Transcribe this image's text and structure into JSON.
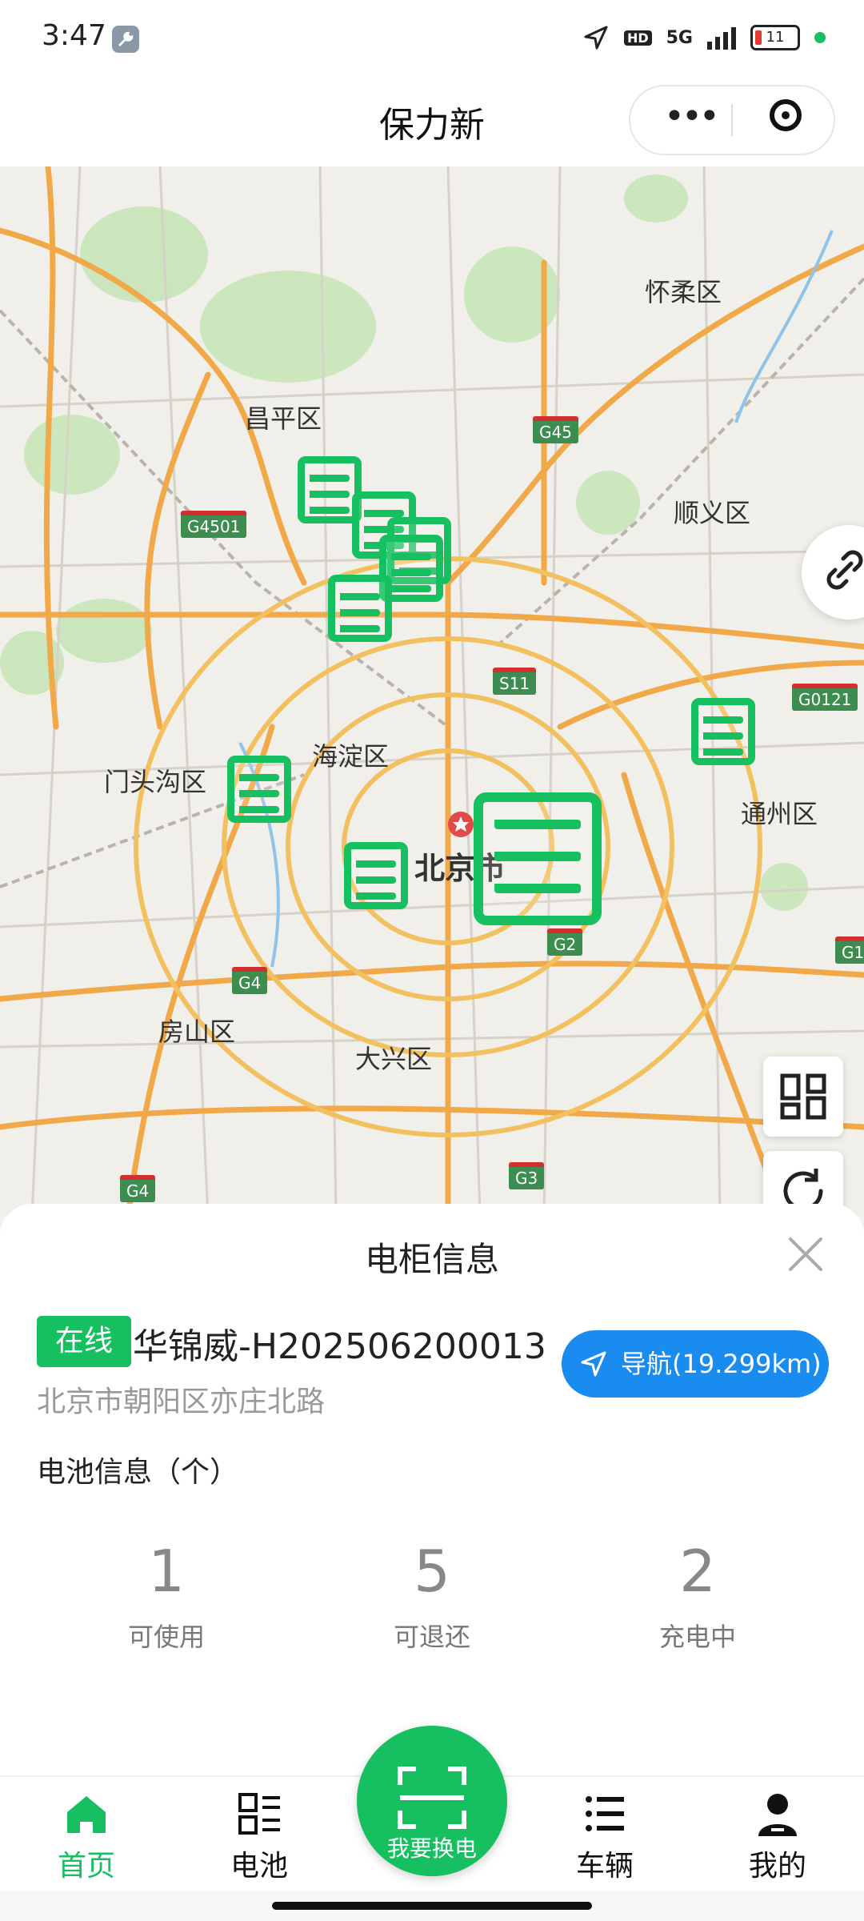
{
  "status_bar": {
    "time": "3:47",
    "network": "5G",
    "hd": "HD",
    "battery": "11",
    "icons": [
      "wrench-icon",
      "location-arrow-icon",
      "hd-icon",
      "signal-icon",
      "battery-icon",
      "green-dot-icon"
    ]
  },
  "header": {
    "title": "保力新",
    "capsule_icons": [
      "more-icon",
      "target-icon"
    ]
  },
  "map": {
    "labels": {
      "huairou": "怀柔区",
      "changping": "昌平区",
      "shunyi": "顺义区",
      "haidian": "海淀区",
      "mentougou": "门头沟区",
      "tongzhou": "通州区",
      "beijing": "北京市",
      "fangshan": "房山区",
      "daxing": "大兴区"
    },
    "shields": {
      "g45": "G45",
      "g4501": "G4501",
      "s11": "S11",
      "g0121": "G0121",
      "g2": "G2",
      "g4a": "G4",
      "g4b": "G4",
      "g3": "G3",
      "g1": "G1"
    },
    "controls": [
      "link-icon",
      "grid-icon",
      "refresh-icon"
    ],
    "cabinet_marker_icon": "cabinet-icon"
  },
  "panel": {
    "title": "电柜信息",
    "status": "在线",
    "cabinet_name": "华锦威-H202506200013",
    "address": "北京市朝阳区亦庄北路",
    "nav_label": "导航(19.299km)",
    "battery_title": "电池信息（个）",
    "stats": [
      {
        "value": "1",
        "label": "可使用"
      },
      {
        "value": "5",
        "label": "可退还"
      },
      {
        "value": "2",
        "label": "充电中"
      }
    ]
  },
  "tabbar": {
    "home": "首页",
    "battery": "电池",
    "swap": "我要换电",
    "vehicle": "车辆",
    "mine": "我的"
  },
  "colors": {
    "brand_green": "#16c060",
    "nav_blue": "#1a8cf0",
    "road_orange": "#f0a848"
  }
}
